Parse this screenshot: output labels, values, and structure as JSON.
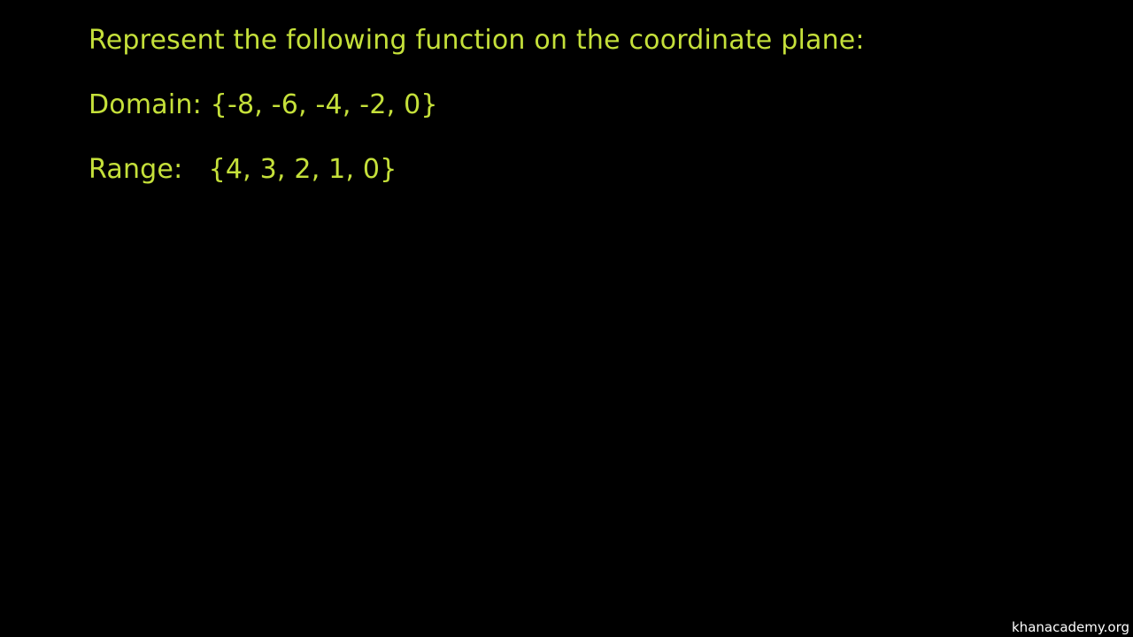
{
  "colors": {
    "background": "#000000",
    "text": "#c5e03a",
    "watermark": "#ffffff"
  },
  "lines": {
    "prompt": "Represent the following function on the coordinate plane:",
    "domain": "Domain: {-8, -6, -4, -2, 0}",
    "range": "Range:   {4, 3, 2, 1, 0}"
  },
  "watermark": "khanacademy.org"
}
